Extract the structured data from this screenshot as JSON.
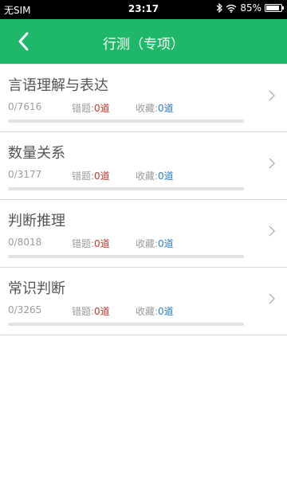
{
  "status_bar": {
    "carrier": "无SIM",
    "time": "23:17",
    "battery": "85%",
    "icons": [
      "bluetooth-icon",
      "wifi-icon",
      "battery-icon"
    ]
  },
  "header": {
    "title": "行测（专项）",
    "back_icon": "chevron-left-icon",
    "color": "#1fb768"
  },
  "items": [
    {
      "name": "言语理解与表达",
      "progress": "0/7616",
      "wrong_label": "错题:",
      "wrong_count": "0道",
      "fav_label": "收藏:",
      "fav_count": "0道",
      "progress_fraction": 0
    },
    {
      "name": "数量关系",
      "progress": "0/3177",
      "wrong_label": "错题:",
      "wrong_count": "0道",
      "fav_label": "收藏:",
      "fav_count": "0道",
      "progress_fraction": 0
    },
    {
      "name": "判断推理",
      "progress": "0/8018",
      "wrong_label": "错题:",
      "wrong_count": "0道",
      "fav_label": "收藏:",
      "fav_count": "0道",
      "progress_fraction": 0
    },
    {
      "name": "常识判断",
      "progress": "0/3265",
      "wrong_label": "错题:",
      "wrong_count": "0道",
      "fav_label": "收藏:",
      "fav_count": "0道",
      "progress_fraction": 0
    }
  ],
  "colors": {
    "accent": "#1fb768",
    "wrong": "#c0392b",
    "favorite": "#2f7ec8"
  }
}
